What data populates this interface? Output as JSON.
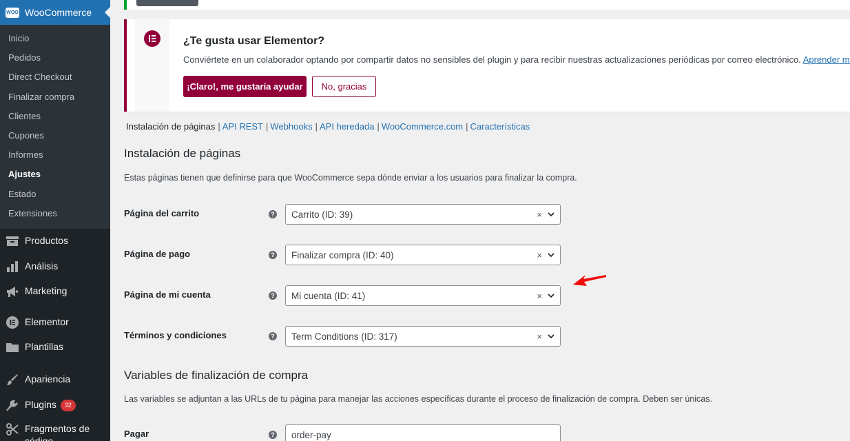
{
  "sidebar": {
    "header": {
      "logo_text": "WOO",
      "title": "WooCommerce"
    },
    "submenu": [
      "Inicio",
      "Pedidos",
      "Direct Checkout",
      "Finalizar compra",
      "Clientes",
      "Cupones",
      "Informes",
      "Ajustes",
      "Estado",
      "Extensiones"
    ],
    "current_submenu": "Ajustes",
    "menu": [
      {
        "label": "Productos",
        "icon": "archive-icon"
      },
      {
        "label": "Análisis",
        "icon": "bar-chart-icon"
      },
      {
        "label": "Marketing",
        "icon": "megaphone-icon"
      },
      {
        "label": "Elementor",
        "icon": "elementor-icon"
      },
      {
        "label": "Plantillas",
        "icon": "folder-icon"
      },
      {
        "label": "Apariencia",
        "icon": "paintbrush-icon"
      },
      {
        "label": "Plugins",
        "icon": "plug-icon",
        "badge": "32"
      },
      {
        "label": "Fragmentos de código",
        "icon": "scissors-icon"
      }
    ]
  },
  "notice": {
    "title": "¿Te gusta usar Elementor?",
    "text": "Conviértete en un colaborador optando por compartir datos no sensibles del plugin y para recibir nuestras actualizaciones periódicas por correo electrónico.",
    "link": "Aprender más",
    "accept_label": "¡Claro!, me gustaría ayudar",
    "decline_label": "No, gracias"
  },
  "subsubsub": {
    "current": "Instalación de páginas",
    "links": [
      "API REST",
      "Webhooks",
      "API heredada",
      "WooCommerce.com",
      "Características"
    ]
  },
  "pages_section": {
    "title": "Instalación de páginas",
    "description": "Estas páginas tienen que definirse para que WooCommerce sepa dónde enviar a los usuarios para finalizar la compra.",
    "rows": [
      {
        "label": "Página del carrito",
        "value": "Carrito (ID: 39)"
      },
      {
        "label": "Página de pago",
        "value": "Finalizar compra (ID: 40)"
      },
      {
        "label": "Página de mi cuenta",
        "value": "Mi cuenta (ID: 41)"
      },
      {
        "label": "Términos y condiciones",
        "value": "Term Conditions (ID: 317)"
      }
    ],
    "help_glyph": "?",
    "clear_glyph": "×"
  },
  "endpoints_section": {
    "title": "Variables de finalización de compra",
    "description": "Las variables se adjuntan a las URLs de tu página para manejar las acciones específicas durante el proceso de finalización de compra. Deben ser únicas.",
    "rows": [
      {
        "label": "Pagar",
        "value": "order-pay"
      }
    ]
  },
  "colors": {
    "wc_blue": "#2271b1",
    "elementor_brand": "#92003b",
    "sidebar_bg": "#1d2327",
    "badge_red": "#d63638",
    "annotation_arrow": "#f00a0a"
  }
}
